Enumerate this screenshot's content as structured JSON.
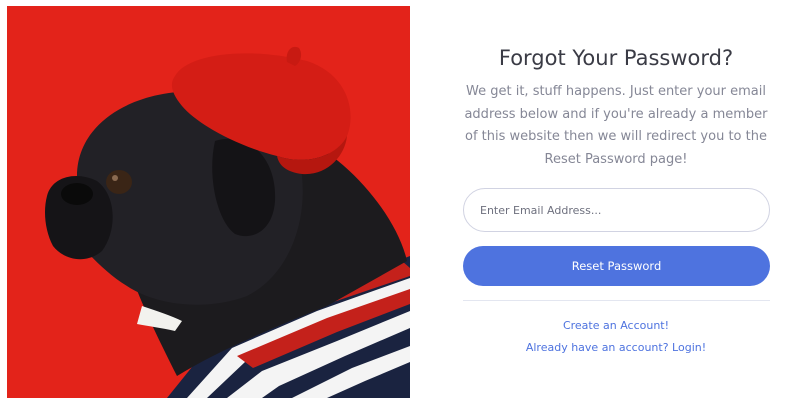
{
  "image": {
    "description_icon": "pug-in-red-beret-photo",
    "background_color": "#e5231b"
  },
  "form": {
    "title": "Forgot Your Password?",
    "subtitle": "We get it, stuff happens. Just enter your email address below and if you're already a member of this website then we will redirect you to the Reset Password page!",
    "email_placeholder": "Enter Email Address...",
    "email_value": "",
    "reset_button_label": "Reset Password",
    "create_account_link": "Create an Account!",
    "login_link": "Already have an account? Login!"
  },
  "colors": {
    "primary": "#4e73df",
    "heading": "#3a3b45",
    "muted": "#858796"
  }
}
